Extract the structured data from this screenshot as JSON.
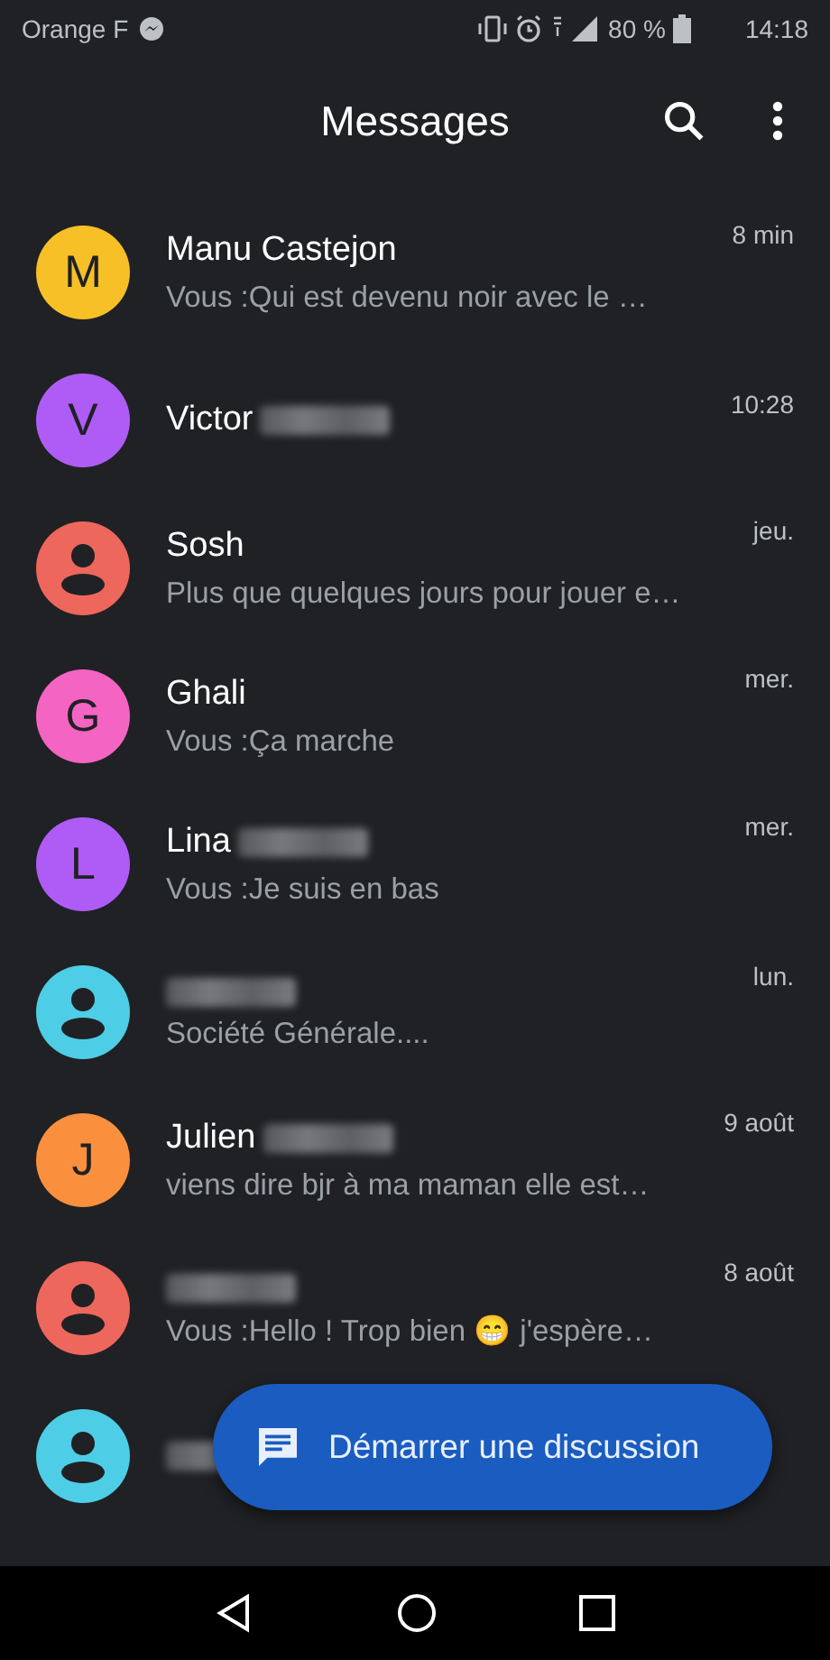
{
  "status_bar": {
    "carrier": "Orange F",
    "battery": "80 %",
    "time": "14:18"
  },
  "header": {
    "title": "Messages"
  },
  "conversations": [
    {
      "avatar": {
        "kind": "letter",
        "letter": "M",
        "color": "#f6c026"
      },
      "name": "Manu Castejon",
      "name_blurred": false,
      "time": "8 min",
      "preview": "Vous :Qui est devenu noir avec le …"
    },
    {
      "avatar": {
        "kind": "letter",
        "letter": "V",
        "color": "#af5cf7"
      },
      "name": "Victor",
      "name_blurred": true,
      "time": "10:28"
    },
    {
      "avatar": {
        "kind": "person",
        "color": "#ee675c"
      },
      "name": "Sosh",
      "name_blurred": false,
      "time": "jeu.",
      "preview": "Plus que quelques jours pour jouer e…"
    },
    {
      "avatar": {
        "kind": "letter",
        "letter": "G",
        "color": "#f464c3"
      },
      "name": "Ghali",
      "name_blurred": false,
      "time": "mer.",
      "preview": "Vous :Ça marche"
    },
    {
      "avatar": {
        "kind": "letter",
        "letter": "L",
        "color": "#af5cf7"
      },
      "name": "Lina",
      "name_blurred": true,
      "time": "mer.",
      "preview": "Vous :Je suis en bas"
    },
    {
      "avatar": {
        "kind": "person",
        "color": "#4ecde6"
      },
      "name_blurred": true,
      "time": "lun.",
      "preview": "Société Générale...."
    },
    {
      "avatar": {
        "kind": "letter",
        "letter": "J",
        "color": "#fa903e"
      },
      "name": "Julien",
      "name_blurred": true,
      "time": "9 août",
      "preview": "viens dire bjr à ma maman elle est…"
    },
    {
      "avatar": {
        "kind": "person",
        "color": "#ee675c"
      },
      "name_blurred": true,
      "time": "8 août",
      "preview": "Vous :Hello ! Trop bien 😁 j'espère…"
    },
    {
      "avatar": {
        "kind": "person",
        "color": "#4ecde6"
      },
      "name_blurred": true
    }
  ],
  "fab": {
    "label": "Démarrer une discussion"
  }
}
